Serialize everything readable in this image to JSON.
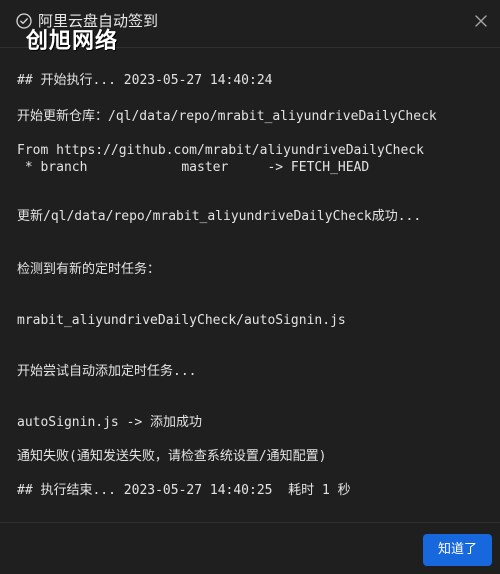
{
  "dialog": {
    "title": "阿里云盘自动签到",
    "watermark": "创旭网络",
    "ok_label": "知道了"
  },
  "log": {
    "lines": [
      "## 开始执行... 2023-05-27 14:40:24",
      "开始更新仓库：/ql/data/repo/mrabit_aliyundriveDailyCheck",
      "From https://github.com/mrabit/aliyundriveDailyCheck",
      " * branch            master     -> FETCH_HEAD",
      "更新/ql/data/repo/mrabit_aliyundriveDailyCheck成功...",
      "检测到有新的定时任务：",
      "mrabit_aliyundriveDailyCheck/autoSignin.js",
      "开始尝试自动添加定时任务...",
      "autoSignin.js -> 添加成功",
      "通知失败(通知发送失败，请检查系统设置/通知配置)",
      "## 执行结束... 2023-05-27 14:40:25  耗时 1 秒"
    ]
  }
}
